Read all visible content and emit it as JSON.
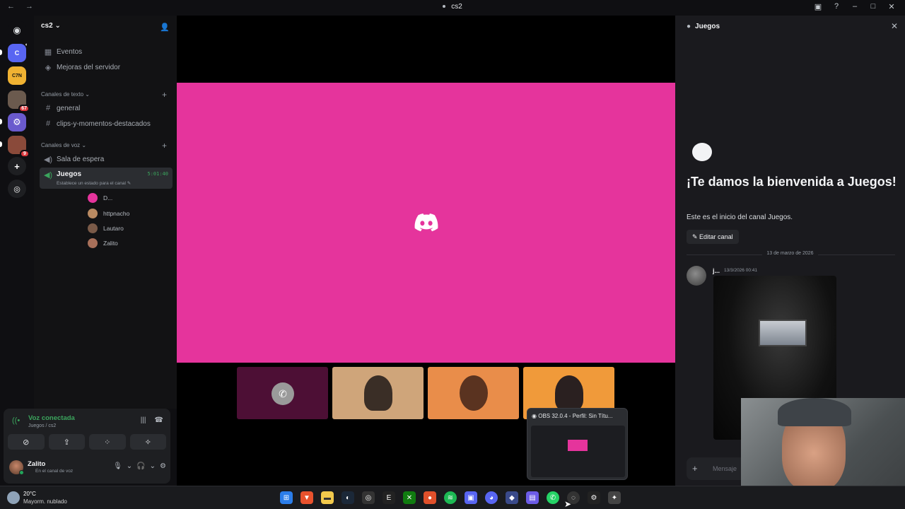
{
  "titlebar": {
    "title": "cs2"
  },
  "servers": [
    {
      "label": "C",
      "color": "#5865f2"
    },
    {
      "label": "C7N",
      "color": "#f0b232"
    },
    {
      "label": "",
      "color": "#6b5a4e",
      "badge": "67"
    },
    {
      "label": "",
      "color": "#6a5acd",
      "badge": ""
    },
    {
      "label": "",
      "color": "#8a4a3a",
      "badge": "9"
    }
  ],
  "guild": {
    "name": "cs2"
  },
  "sidebar": {
    "events": "Eventos",
    "boosts": "Mejoras del servidor",
    "text_category": "Canales de texto",
    "text_channels": [
      "general",
      "clips-y-momentos-destacados"
    ],
    "voice_category": "Canales de voz",
    "voice_channels": [
      "Sala de espera"
    ],
    "active_channel": {
      "name": "Juegos",
      "time": "5:01:40",
      "status": "Establece un estado para el canal"
    },
    "voice_users": [
      "D...",
      "httpnacho",
      "Lautaro",
      "Zalito"
    ]
  },
  "voice_panel": {
    "title": "Voz conectada",
    "subtitle": "Juegos / cs2"
  },
  "user": {
    "name": "Zalito",
    "status": "En el canal de voz"
  },
  "obs": {
    "title": "OBS 32.0.4 - Perfil: Sin Títu..."
  },
  "chat": {
    "header": "Juegos",
    "welcome": "¡Te damos la bienvenida a Juegos!",
    "start": "Este es el inicio del canal Juegos.",
    "edit": "Editar canal",
    "date": "13 de marzo de 2026",
    "author": "j...",
    "timestamp": "13/3/2026 00:41",
    "placeholder": "Mensaje"
  },
  "weather": {
    "temp": "20°C",
    "condition": "Mayorm. nublado"
  }
}
